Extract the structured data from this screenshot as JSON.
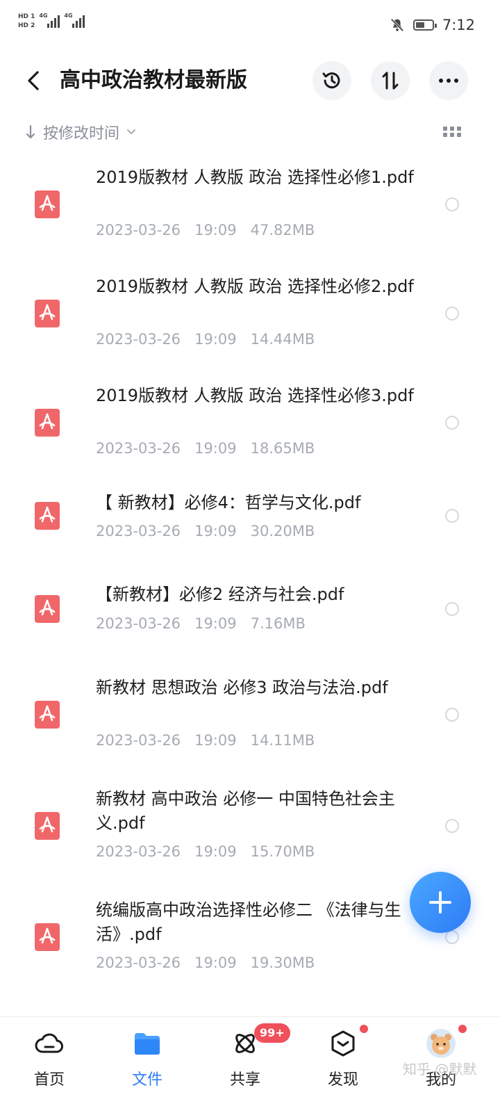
{
  "status_bar": {
    "hd1": "HD 1",
    "hd2": "HD 2",
    "sim1": "4G",
    "sim2": "4G",
    "time": "7:12"
  },
  "header": {
    "title": "高中政治教材最新版",
    "back_icon": "chevron-left-icon",
    "history_icon": "history-icon",
    "sort_icon": "sort-arrows-icon",
    "more_icon": "more-icon"
  },
  "sort": {
    "label": "按修改时间"
  },
  "files": [
    {
      "name": "2019版教材 人教版 政治 选择性必修1.pdf",
      "date": "2023-03-26",
      "time": "19:09",
      "size": "47.82MB"
    },
    {
      "name": "2019版教材 人教版 政治 选择性必修2.pdf",
      "date": "2023-03-26",
      "time": "19:09",
      "size": "14.44MB"
    },
    {
      "name": "2019版教材 人教版 政治 选择性必修3.pdf",
      "date": "2023-03-26",
      "time": "19:09",
      "size": "18.65MB"
    },
    {
      "name": "【 新教材】必修4：哲学与文化.pdf",
      "date": "2023-03-26",
      "time": "19:09",
      "size": "30.20MB"
    },
    {
      "name": "【新教材】必修2 经济与社会.pdf",
      "date": "2023-03-26",
      "time": "19:09",
      "size": "7.16MB"
    },
    {
      "name": "新教材 思想政治 必修3 政治与法治.pdf",
      "date": "2023-03-26",
      "time": "19:09",
      "size": "14.11MB"
    },
    {
      "name": "新教材 高中政治 必修一 中国特色社会主义.pdf",
      "date": "2023-03-26",
      "time": "19:09",
      "size": "15.70MB"
    },
    {
      "name": "统编版高中政治选择性必修二 《法律与生活》.pdf",
      "date": "2023-03-26",
      "time": "19:09",
      "size": "19.30MB"
    }
  ],
  "nav": {
    "home": "首页",
    "files": "文件",
    "share": "共享",
    "discover": "发现",
    "mine": "我的",
    "share_badge": "99+"
  },
  "watermark": "知乎 @默默",
  "colors": {
    "accent": "#2f7cf6",
    "pdf_red": "#f0676a",
    "badge_red": "#f0505c",
    "meta_gray": "#a6abb3"
  }
}
